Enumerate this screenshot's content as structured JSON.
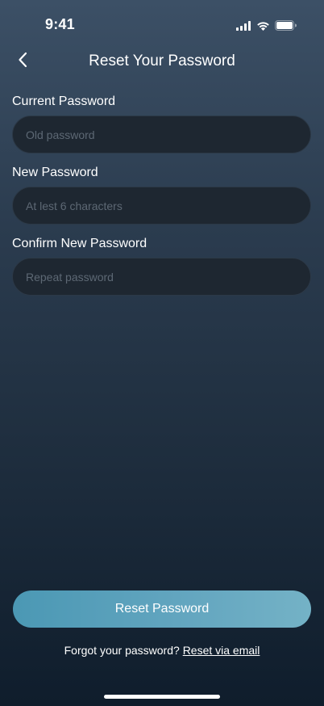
{
  "status_bar": {
    "time": "9:41",
    "icons": [
      "cellular-signal-icon",
      "wifi-icon",
      "battery-icon"
    ]
  },
  "header": {
    "back_icon": "chevron-left-icon",
    "title": "Reset Your Password"
  },
  "form": {
    "current_password": {
      "label": "Current Password",
      "placeholder": "Old password",
      "value": ""
    },
    "new_password": {
      "label": "New Password",
      "placeholder": "At lest 6 characters",
      "value": ""
    },
    "confirm_password": {
      "label": "Confirm New Password",
      "placeholder": "Repeat password",
      "value": ""
    }
  },
  "actions": {
    "submit_label": "Reset Password"
  },
  "footer": {
    "prompt": "Forgot your password?",
    "link_label": "Reset via email"
  },
  "colors": {
    "background_top": "#3c5066",
    "background_bottom": "#0f1d2c",
    "input_background": "#1e2731",
    "placeholder": "#5d6874",
    "button_gradient_start": "#4b98b4",
    "button_gradient_end": "#74b2c6",
    "text": "#ffffff"
  }
}
